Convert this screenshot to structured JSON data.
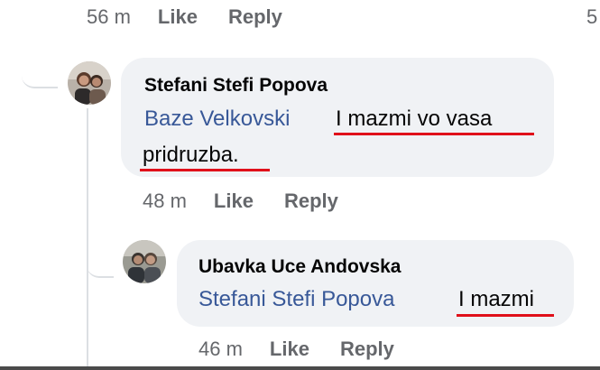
{
  "top_actions": {
    "time": "56 m",
    "like": "Like",
    "reply": "Reply",
    "edge_char": "5"
  },
  "comment_1": {
    "author": "Stefani Stefi Popova",
    "mention": "Baze Velkovski",
    "text_line_1": "I mazmi vo vasa",
    "text_line_2": "pridruzba.",
    "time": "48 m",
    "like": "Like",
    "reply": "Reply"
  },
  "comment_2": {
    "author": "Ubavka Uce Andovska",
    "mention": "Stefani Stefi Popova",
    "text": "I mazmi",
    "time": "46 m",
    "like": "Like",
    "reply": "Reply"
  },
  "colors": {
    "bubble": "#f0f2f5",
    "mention": "#385898",
    "meta": "#65676b",
    "text": "#050505",
    "underline": "#e0101a"
  },
  "icons": [
    "avatar-stefani",
    "avatar-ubavka"
  ]
}
